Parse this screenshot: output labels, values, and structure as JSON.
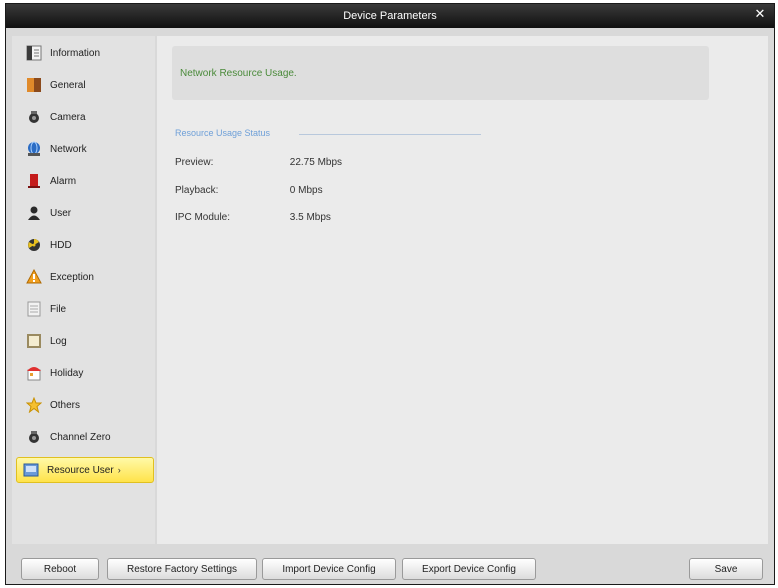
{
  "window": {
    "title": "Device Parameters"
  },
  "sidebar": {
    "items": [
      {
        "label": "Information",
        "icon": "info-icon"
      },
      {
        "label": "General",
        "icon": "general-icon"
      },
      {
        "label": "Camera",
        "icon": "camera-icon"
      },
      {
        "label": "Network",
        "icon": "network-icon"
      },
      {
        "label": "Alarm",
        "icon": "alarm-icon"
      },
      {
        "label": "User",
        "icon": "user-icon"
      },
      {
        "label": "HDD",
        "icon": "hdd-icon"
      },
      {
        "label": "Exception",
        "icon": "exception-icon"
      },
      {
        "label": "File",
        "icon": "file-icon"
      },
      {
        "label": "Log",
        "icon": "log-icon"
      },
      {
        "label": "Holiday",
        "icon": "holiday-icon"
      },
      {
        "label": "Others",
        "icon": "others-icon"
      },
      {
        "label": "Channel Zero",
        "icon": "channel-zero-icon"
      },
      {
        "label": "Resource User",
        "icon": "resource-icon",
        "selected": true
      }
    ]
  },
  "content": {
    "header": "Network Resource Usage.",
    "section_title": "Resource Usage Status",
    "rows": [
      {
        "label": "Preview:",
        "value": "22.75 Mbps"
      },
      {
        "label": "Playback:",
        "value": "0 Mbps"
      },
      {
        "label": "IPC Module:",
        "value": "3.5 Mbps"
      }
    ]
  },
  "footer": {
    "reboot": "Reboot",
    "restore": "Restore Factory Settings",
    "import": "Import Device Config",
    "export": "Export Device Config",
    "save": "Save"
  },
  "colors": {
    "selected_bg": "#ffe34a",
    "title_bar": "#101010",
    "header_text": "#4a8a3a",
    "section_title": "#6fa0d8"
  }
}
